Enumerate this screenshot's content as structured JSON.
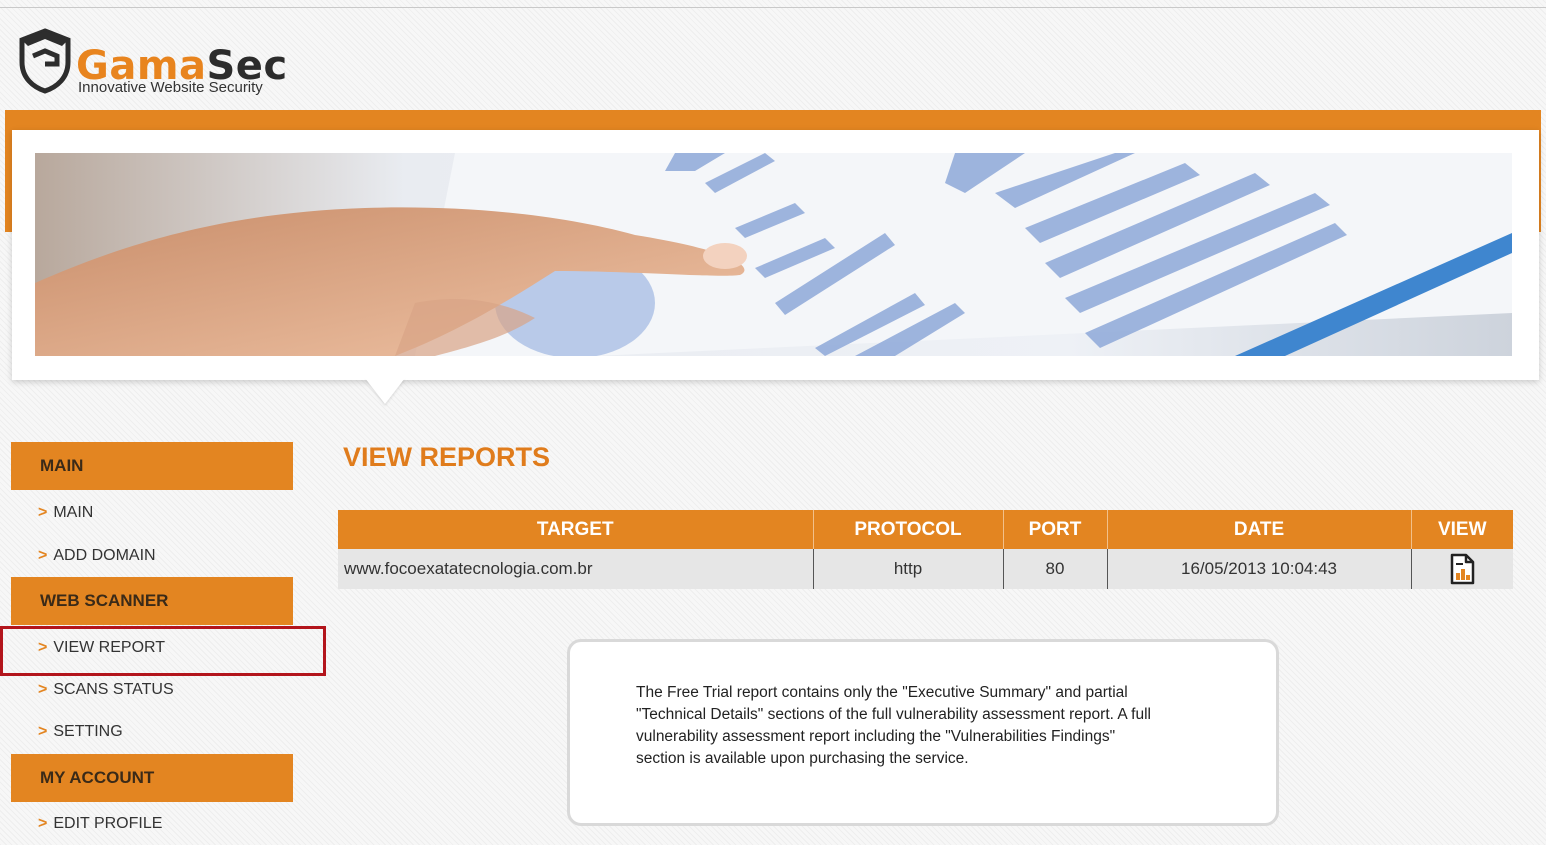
{
  "brand": {
    "name_part1": "Gama",
    "name_part2": "Sec",
    "tagline": "Innovative Website Security",
    "accent_color": "#e38521"
  },
  "sidebar": {
    "sections": [
      {
        "title": "MAIN",
        "items": [
          "MAIN",
          "ADD DOMAIN"
        ]
      },
      {
        "title": "WEB SCANNER",
        "items": [
          "VIEW REPORT",
          "SCANS STATUS",
          "SETTING"
        ]
      },
      {
        "title": "MY ACCOUNT",
        "items": [
          "EDIT PROFILE"
        ]
      }
    ],
    "arrow": ">",
    "highlighted_item": "VIEW REPORT"
  },
  "main": {
    "title": "VIEW REPORTS",
    "table": {
      "headers": [
        "TARGET",
        "PROTOCOL",
        "PORT",
        "DATE",
        "VIEW"
      ],
      "rows": [
        {
          "target": "www.focoexatatecnologia.com.br",
          "protocol": "http",
          "port": "80",
          "date": "16/05/2013 10:04:43",
          "view_icon": "report-chart-icon"
        }
      ]
    },
    "notice": "The Free Trial report contains only the \"Executive Summary\" and partial \"Technical Details\" sections of the full vulnerability assessment report. A full vulnerability assessment report including the \"Vulnerabilities Findings\" section is available upon purchasing the service."
  }
}
